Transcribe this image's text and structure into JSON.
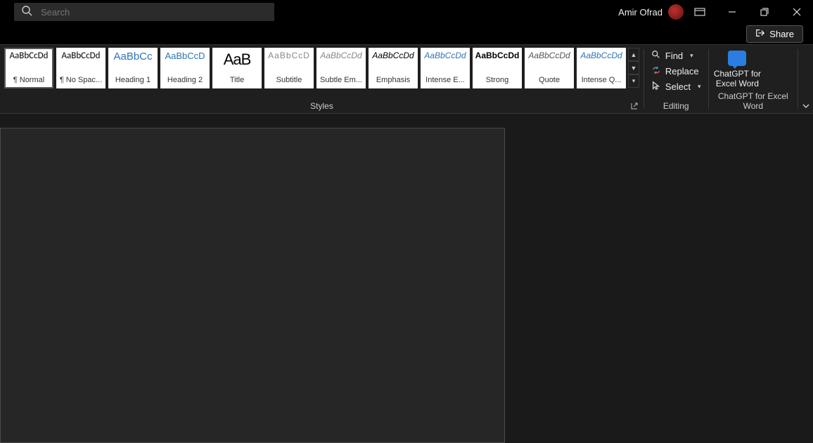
{
  "titlebar": {
    "search_placeholder": "Search",
    "user_name": "Amir Ofrad"
  },
  "subbar": {
    "share_label": "Share"
  },
  "styles_group": {
    "label": "Styles",
    "items": [
      {
        "preview": "AaBbCcDd",
        "name": "¶ Normal",
        "cls": "sp-normal",
        "selected": true
      },
      {
        "preview": "AaBbCcDd",
        "name": "¶ No Spac...",
        "cls": "sp-normal"
      },
      {
        "preview": "AaBbCc",
        "name": "Heading 1",
        "cls": "sp-h1"
      },
      {
        "preview": "AaBbCcD",
        "name": "Heading 2",
        "cls": "sp-h2"
      },
      {
        "preview": "AaB",
        "name": "Title",
        "cls": "sp-title"
      },
      {
        "preview": "AaBbCcD",
        "name": "Subtitle",
        "cls": "sp-subtitle"
      },
      {
        "preview": "AaBbCcDd",
        "name": "Subtle Em...",
        "cls": "sp-subem"
      },
      {
        "preview": "AaBbCcDd",
        "name": "Emphasis",
        "cls": "sp-emph"
      },
      {
        "preview": "AaBbCcDd",
        "name": "Intense E...",
        "cls": "sp-inte"
      },
      {
        "preview": "AaBbCcDd",
        "name": "Strong",
        "cls": "sp-strong"
      },
      {
        "preview": "AaBbCcDd",
        "name": "Quote",
        "cls": "sp-quote"
      },
      {
        "preview": "AaBbCcDd",
        "name": "Intense Q...",
        "cls": "sp-intq"
      }
    ]
  },
  "editing_group": {
    "label": "Editing",
    "find": "Find",
    "replace": "Replace",
    "select": "Select"
  },
  "chatgpt_group": {
    "label": "ChatGPT for Excel Word",
    "btn_line1": "ChatGPT for",
    "btn_line2": "Excel Word"
  }
}
